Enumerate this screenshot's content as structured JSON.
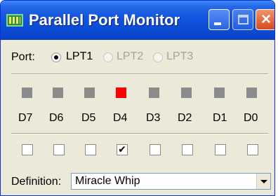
{
  "window": {
    "title": "Parallel Port Monitor",
    "controls": {
      "minimize": "minimize",
      "maximize": "maximize",
      "close": "×"
    }
  },
  "port": {
    "label": "Port:",
    "options": [
      {
        "label": "LPT1",
        "selected": true,
        "enabled": true
      },
      {
        "label": "LPT2",
        "selected": false,
        "enabled": false
      },
      {
        "label": "LPT3",
        "selected": false,
        "enabled": false
      }
    ]
  },
  "bits": [
    {
      "label": "D7",
      "led_on": false,
      "checked": false
    },
    {
      "label": "D6",
      "led_on": false,
      "checked": false
    },
    {
      "label": "D5",
      "led_on": false,
      "checked": false
    },
    {
      "label": "D4",
      "led_on": true,
      "checked": true
    },
    {
      "label": "D3",
      "led_on": false,
      "checked": false
    },
    {
      "label": "D2",
      "led_on": false,
      "checked": false
    },
    {
      "label": "D1",
      "led_on": false,
      "checked": false
    },
    {
      "label": "D0",
      "led_on": false,
      "checked": false
    }
  ],
  "definition": {
    "label": "Definition:",
    "value": "Miracle Whip"
  },
  "colors": {
    "led_on": "#ff0000",
    "led_off": "#8b8b8b",
    "titlebar": "#1154e0",
    "window_bg": "#ece9d8"
  },
  "icons": {
    "app": "parallel-port-icon",
    "dropdown": "chevron-down-icon"
  }
}
